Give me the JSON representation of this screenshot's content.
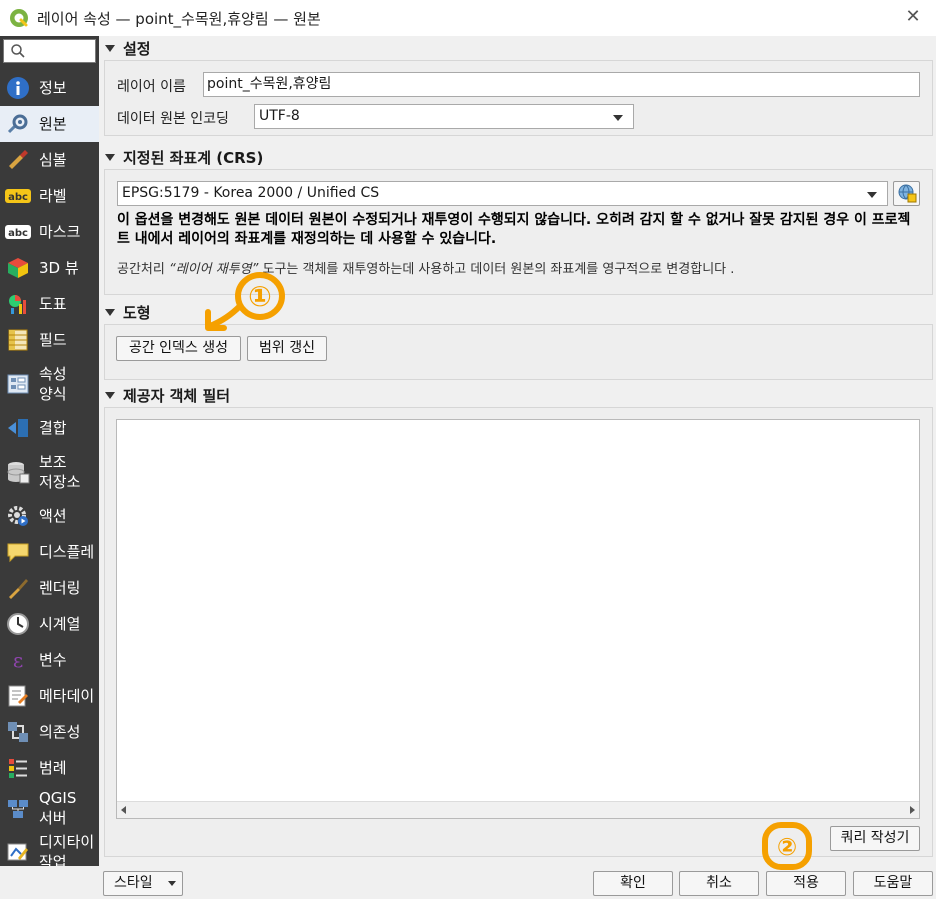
{
  "window": {
    "title": "레이어 속성 — point_수목원,휴양림 — 원본",
    "app_icon": "qgis-icon",
    "close_icon": "close-icon"
  },
  "sidebar": {
    "search_placeholder": "",
    "items": [
      {
        "label": "정보",
        "icon": "info-icon"
      },
      {
        "label": "원본",
        "icon": "source-settings-icon",
        "active": true
      },
      {
        "label": "심볼",
        "icon": "symbology-brush-icon"
      },
      {
        "label": "라벨",
        "icon": "label-abc-icon"
      },
      {
        "label": "마스크",
        "icon": "mask-abc-icon"
      },
      {
        "label": "3D 뷰",
        "icon": "cube-3d-icon"
      },
      {
        "label": "도표",
        "icon": "diagram-icon"
      },
      {
        "label": "필드",
        "icon": "fields-icon"
      },
      {
        "label": "속성\n양식",
        "icon": "attributes-form-icon"
      },
      {
        "label": "결합",
        "icon": "join-icon"
      },
      {
        "label": "보조\n저장소",
        "icon": "auxiliary-storage-icon"
      },
      {
        "label": "액션",
        "icon": "action-gear-icon"
      },
      {
        "label": "디스플레",
        "icon": "display-tooltip-icon"
      },
      {
        "label": "렌더링",
        "icon": "rendering-brush-icon"
      },
      {
        "label": "시계열",
        "icon": "temporal-clock-icon"
      },
      {
        "label": "변수",
        "icon": "variable-epsilon-icon"
      },
      {
        "label": "메타데이",
        "icon": "metadata-icon"
      },
      {
        "label": "의존성",
        "icon": "dependencies-icon"
      },
      {
        "label": "범례",
        "icon": "legend-icon"
      },
      {
        "label": "QGIS\n서버",
        "icon": "qgis-server-icon"
      },
      {
        "label": "디지타이\n작업",
        "icon": "digitizing-icon"
      }
    ]
  },
  "settings": {
    "header": "설정",
    "layer_name_label": "레이어 이름",
    "layer_name_value": "point_수목원,휴양림",
    "encoding_label": "데이터 원본 인코딩",
    "encoding_value": "UTF-8"
  },
  "crs": {
    "header": "지정된 좌표계 (CRS)",
    "value": "EPSG:5179 - Korea 2000 / Unified CS",
    "warning": "이 옵션을 변경해도 원본 데이터 원본이 수정되거나 재투영이 수행되지 않습니다. 오히려 감지 할 수 없거나 잘못 감지된 경우 이 프로젝트 내에서 레이어의 좌표계를 재정의하는 데 사용할 수 있습니다.",
    "note_prefix": "공간처리 ",
    "note_italic": "“레이어 재투영”",
    "note_suffix": " 도구는 객체를 재투영하는데 사용하고 데이터 원본의 좌표계를 영구적으로 변경합니다 ."
  },
  "geometry": {
    "header": "도형",
    "spatial_index_button": "공간 인덱스 생성",
    "update_extent_button": "범위 갱신"
  },
  "filter": {
    "header": "제공자 객체 필터",
    "query": "",
    "query_builder_button": "쿼리 작성기"
  },
  "bottom": {
    "style_button": "스타일",
    "ok_button": "확인",
    "cancel_button": "취소",
    "apply_button": "적용",
    "help_button": "도움말"
  },
  "annotations": {
    "marker1": "①",
    "marker2": "②",
    "color": "#f5a000"
  }
}
